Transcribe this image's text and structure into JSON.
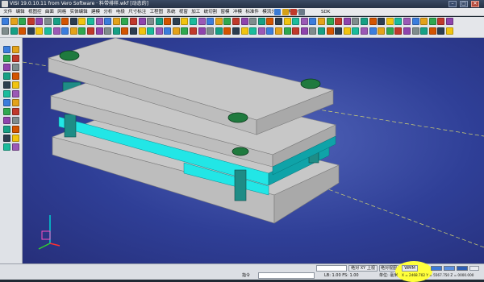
{
  "title_bar": {
    "title": "VISI 19.0.10.11 from Vero Software · 料带排样.wkf [动态的]",
    "minimize": "–",
    "maximize": "□",
    "close": "✕"
  },
  "menu": {
    "items": [
      "文件",
      "编辑",
      "视图控",
      "曲面",
      "网格",
      "实体编辑",
      "建模",
      "分析",
      "电极",
      "尺寸标注",
      "工程图",
      "系统",
      "视窗",
      "加工",
      "统切割",
      "窗模",
      "冲模",
      "标准件",
      "模流分析",
      "数模",
      "?"
    ],
    "sdk_label": "SDK"
  },
  "colors": {
    "plate_top": "#c7c7c7",
    "plate_side": "#a9a9a9",
    "plate_front": "#bdbdbd",
    "strip": "#22e6e6",
    "strip_dark": "#0fa3a8",
    "pillar": "#1e8c86",
    "bolt": "#1f7a3e",
    "viewport_bg": "#2f3f97"
  },
  "status_bar": {
    "command_label": "指令",
    "absolute_top_view": "绝对 XY 上视",
    "absolute_view": "绝对视图",
    "wmm_button": "WMM",
    "layer_info": "LB: 1.00 FS: 1.00",
    "unit_label": "单位: 毫米",
    "coords": "X = 2468.702  Y = 5567.750  Z = 0000.000"
  }
}
